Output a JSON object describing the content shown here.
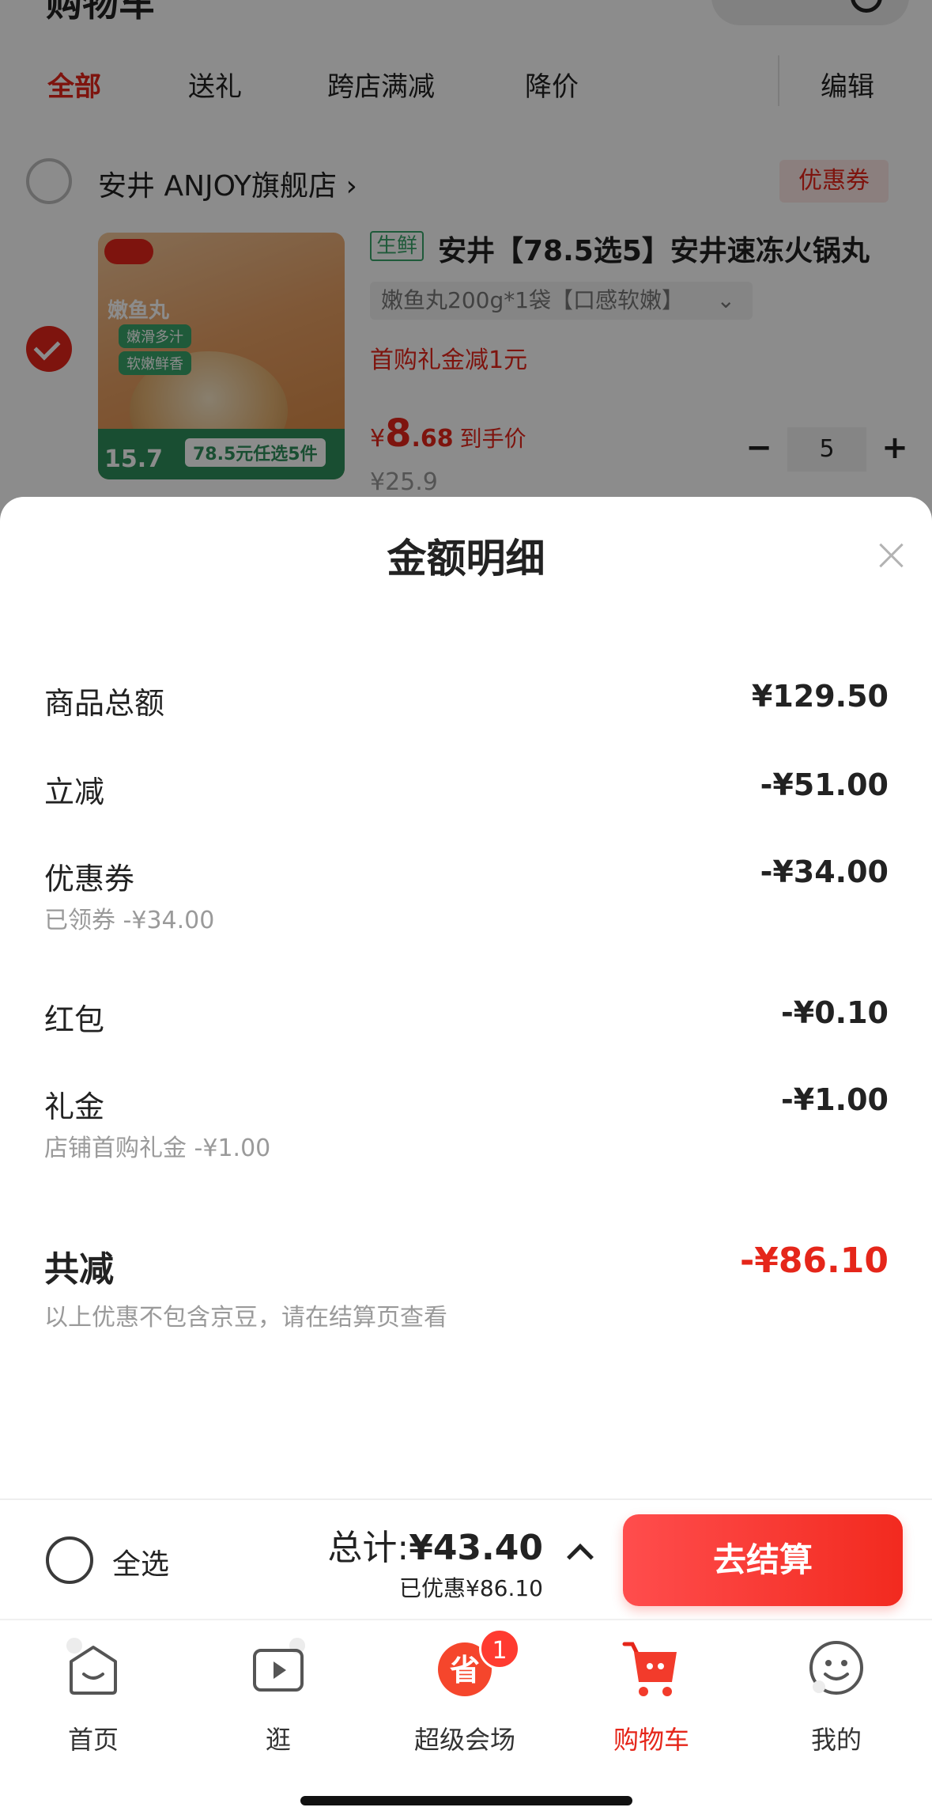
{
  "header": {
    "title": "购物车"
  },
  "filter_tabs": [
    {
      "label": "全部",
      "active": true
    },
    {
      "label": "送礼",
      "active": false
    },
    {
      "label": "跨店满减",
      "active": false
    },
    {
      "label": "降价",
      "active": false
    }
  ],
  "edit_label": "编辑",
  "store": {
    "name": "安井 ANJOY旗舰店",
    "arrow": "›",
    "coupon_label": "优惠券"
  },
  "product": {
    "fresh_tag": "生鲜",
    "title": "安井【78.5选5】安井速冻火锅丸",
    "spec": "嫩鱼丸200g*1袋【口感软嫩】",
    "spec_chevron": "⌄",
    "first_gift": "首购礼金减1元",
    "price_yen": "¥",
    "price_int": "8",
    "price_dec": ".68",
    "price_label": "到手价",
    "original_price": "¥25.9",
    "quantity": "5",
    "image_text": {
      "name": "嫩鱼丸",
      "tag1": "嫩滑多汁",
      "tag2": "软嫩鲜香",
      "promo_price": "15.7",
      "promo_text": "78.5元任选5件"
    }
  },
  "sheet": {
    "title": "金额明细",
    "rows": [
      {
        "label": "商品总额",
        "value": "¥129.50",
        "sub": ""
      },
      {
        "label": "立减",
        "value": "-¥51.00",
        "sub": ""
      },
      {
        "label": "优惠券",
        "value": "-¥34.00",
        "sub": "已领券 -¥34.00"
      },
      {
        "label": "红包",
        "value": "-¥0.10",
        "sub": ""
      },
      {
        "label": "礼金",
        "value": "-¥1.00",
        "sub": "店铺首购礼金 -¥1.00"
      }
    ],
    "total_label": "共减",
    "total_value": "-¥86.10",
    "note": "以上优惠不包含京豆，请在结算页查看"
  },
  "checkout": {
    "select_all": "全选",
    "total_prefix": "总计:",
    "total_amount": "¥43.40",
    "saved": "已优惠¥86.10",
    "button": "去结算"
  },
  "nav": [
    {
      "label": "首页",
      "icon": "home-icon",
      "active": false
    },
    {
      "label": "逛",
      "icon": "video-icon",
      "active": false
    },
    {
      "label": "超级会场",
      "icon": "super-venue-icon",
      "active": false,
      "badge": "1"
    },
    {
      "label": "购物车",
      "icon": "cart-icon",
      "active": true
    },
    {
      "label": "我的",
      "icon": "profile-icon",
      "active": false
    }
  ],
  "colors": {
    "accent": "#e5261a",
    "fresh_green": "#3aa56b"
  }
}
